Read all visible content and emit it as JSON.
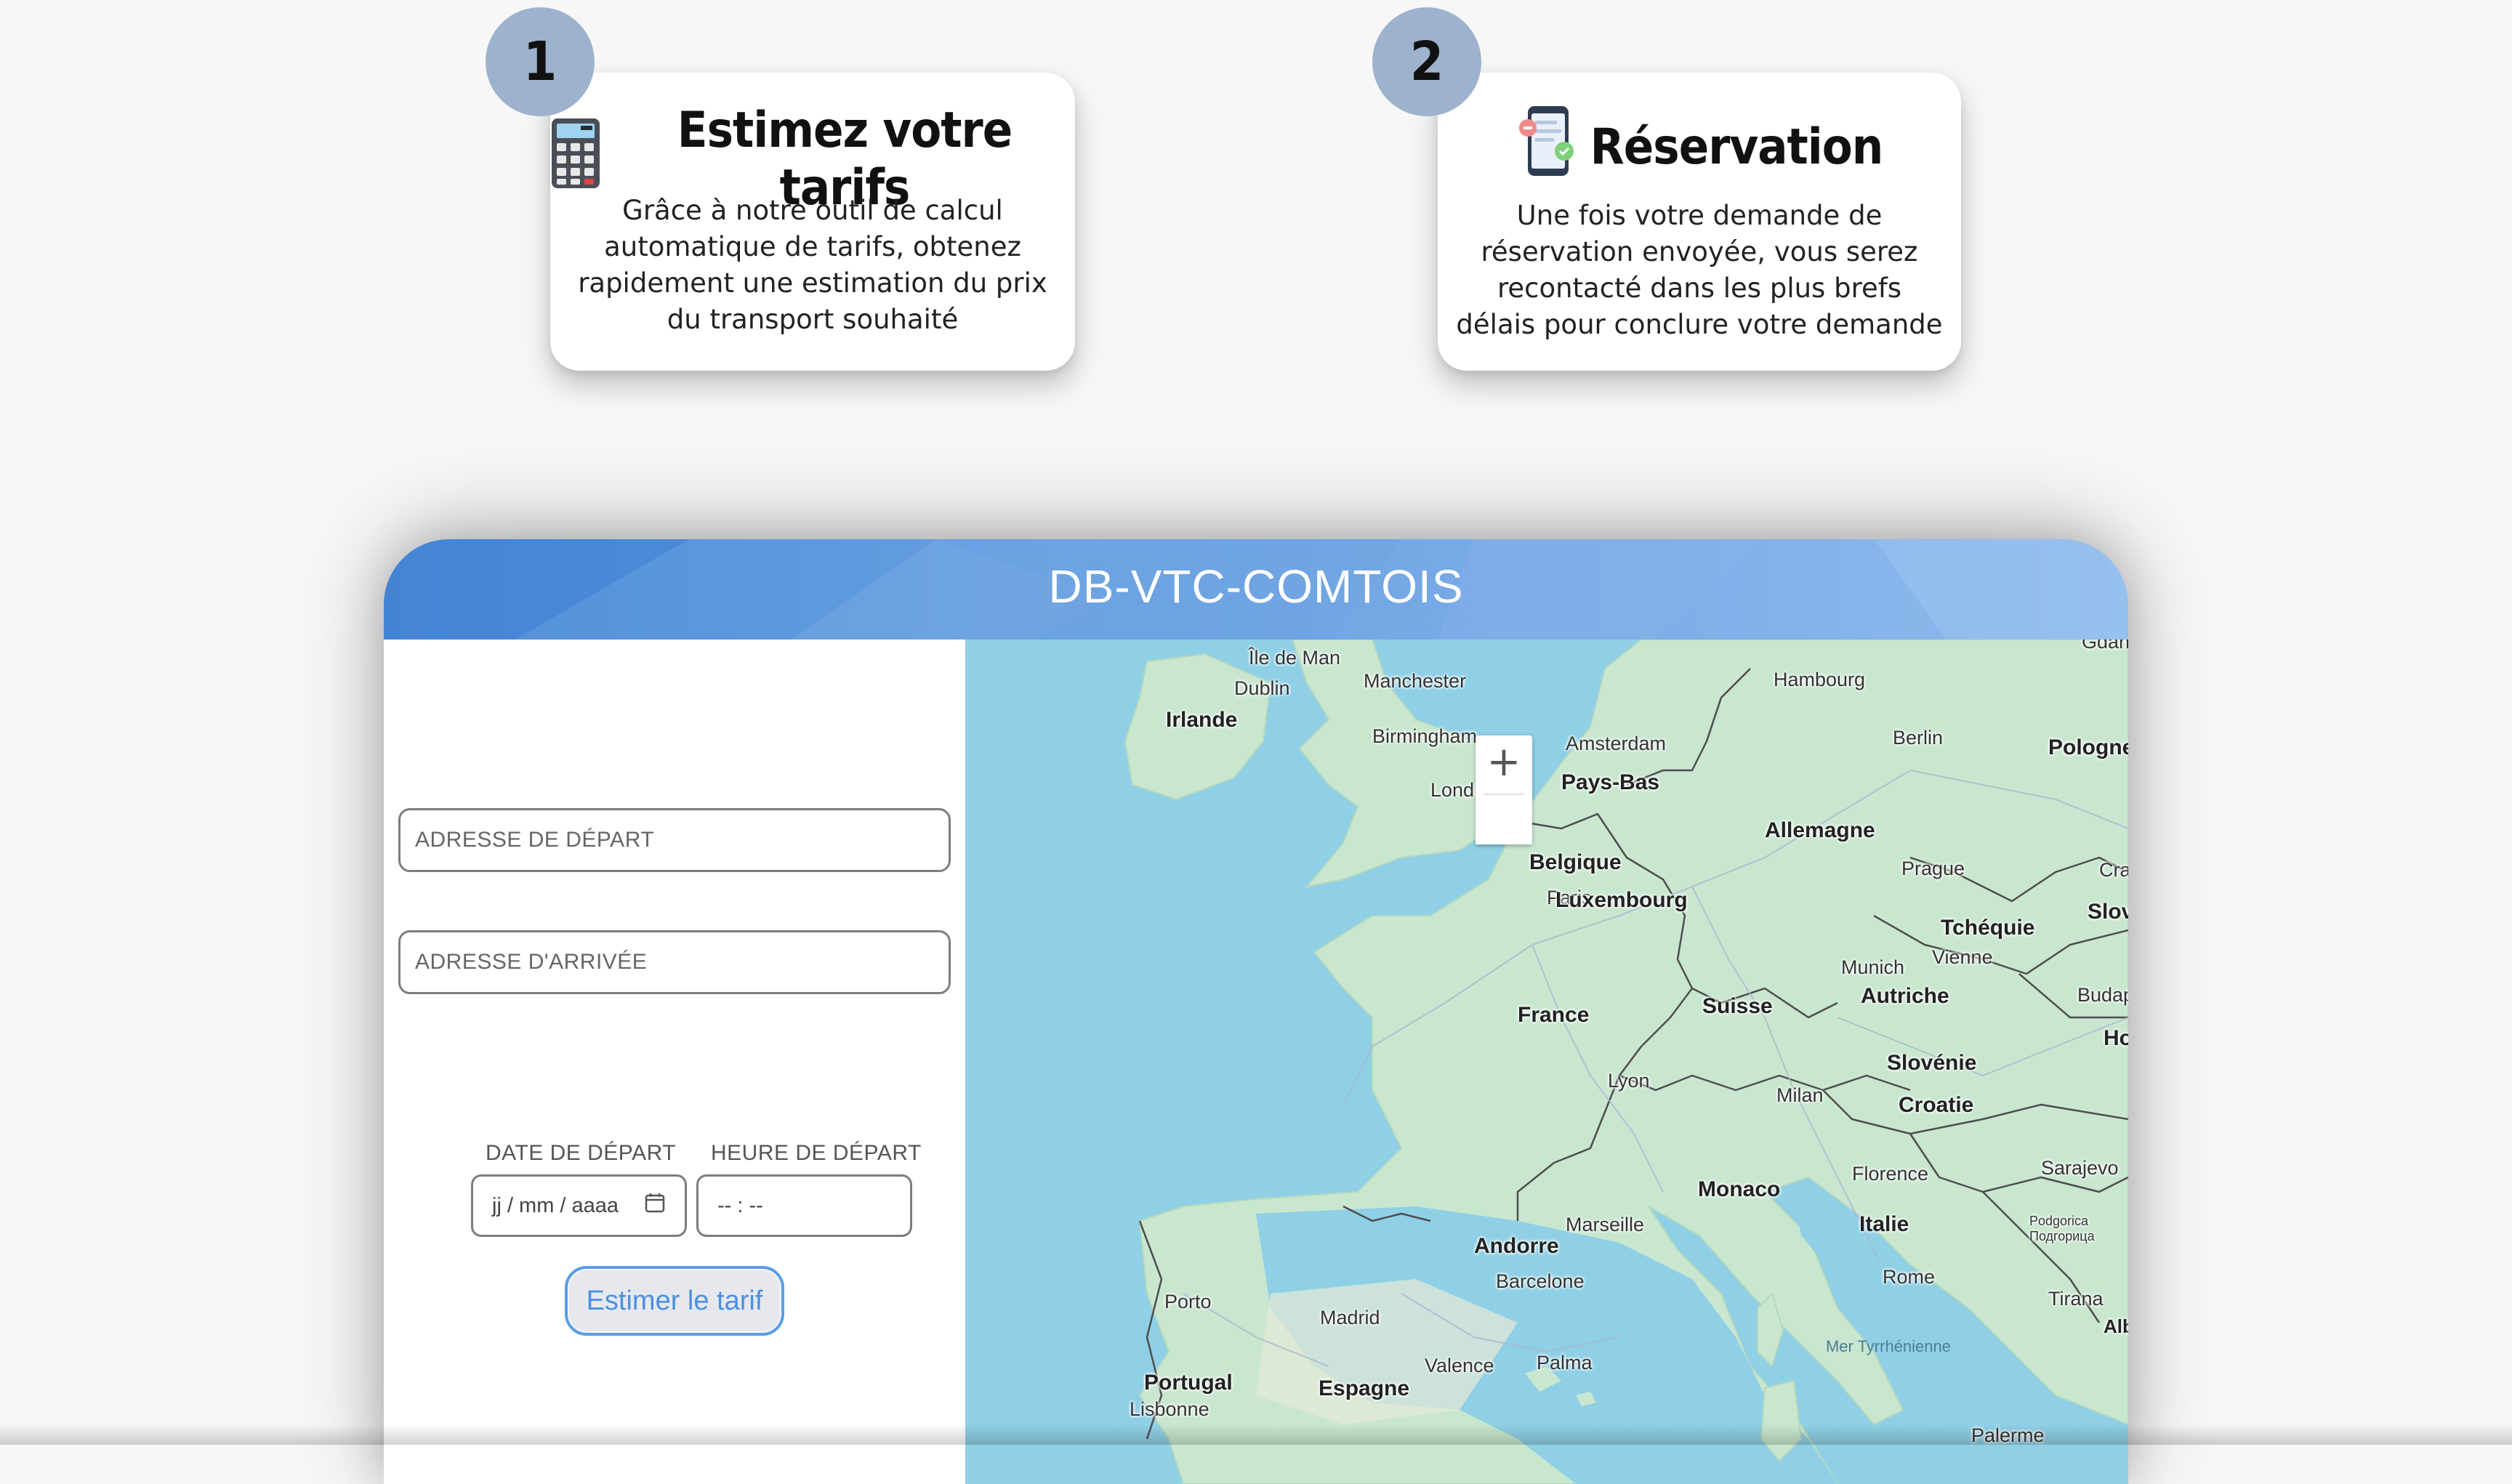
{
  "steps": [
    {
      "number": "1",
      "icon": "calculator-icon",
      "title": "Estimez votre tarifs",
      "text": "Grâce à notre outil de calcul automatique de tarifs, obtenez rapidement une estimation du prix du transport souhaité"
    },
    {
      "number": "2",
      "icon": "phone-booking-icon",
      "title": "Réservation",
      "text": "Une fois votre demande de réservation envoyée, vous serez recontacté dans les plus brefs délais pour conclure votre demande"
    }
  ],
  "widget": {
    "title": "DB-VTC-COMTOIS",
    "header_color": "#6aa2e2"
  },
  "form": {
    "start_placeholder": "ADRESSE DE DÉPART",
    "end_placeholder": "ADRESSE D'ARRIVÉE",
    "date_label": "DATE DE DÉPART",
    "time_label": "HEURE DE DÉPART",
    "date_placeholder": "jj / mm / aaaa",
    "time_placeholder": "-- : --",
    "estimate_button": "Estimer le tarif",
    "accent_color": "#4a90e2"
  },
  "map": {
    "zoom_in_label": "+",
    "countries": [
      "Irlande",
      "Pays-Bas",
      "Allemagne",
      "Belgique",
      "Luxembourg",
      "Tchéquie",
      "France",
      "Suisse",
      "Autriche",
      "Slovénie",
      "Croatie",
      "Italie",
      "Monaco",
      "Andorre",
      "Portugal",
      "Espagne",
      "Pologne",
      "Slovaq",
      "Hong",
      "Alban"
    ],
    "cities": [
      "Île de Man",
      "Dublin",
      "Manchester",
      "Birmingham",
      "Londres",
      "Amsterdam",
      "Hambourg",
      "Berlin",
      "Prague",
      "Paris",
      "Munich",
      "Vienne",
      "Budape",
      "Crac",
      "Lyon",
      "Milan",
      "Marseille",
      "Florence",
      "Sarajevo",
      "Podgorica Подгорица",
      "Rome",
      "Tirana",
      "Barcelone",
      "Madrid",
      "Valence",
      "Palma",
      "Porto",
      "Lisbonne",
      "Palerme",
      "Gdańsk"
    ],
    "sea": "Mer Tyrrhénienne",
    "water_color": "#8fd0e6",
    "land_color": "#c9e7cf"
  }
}
